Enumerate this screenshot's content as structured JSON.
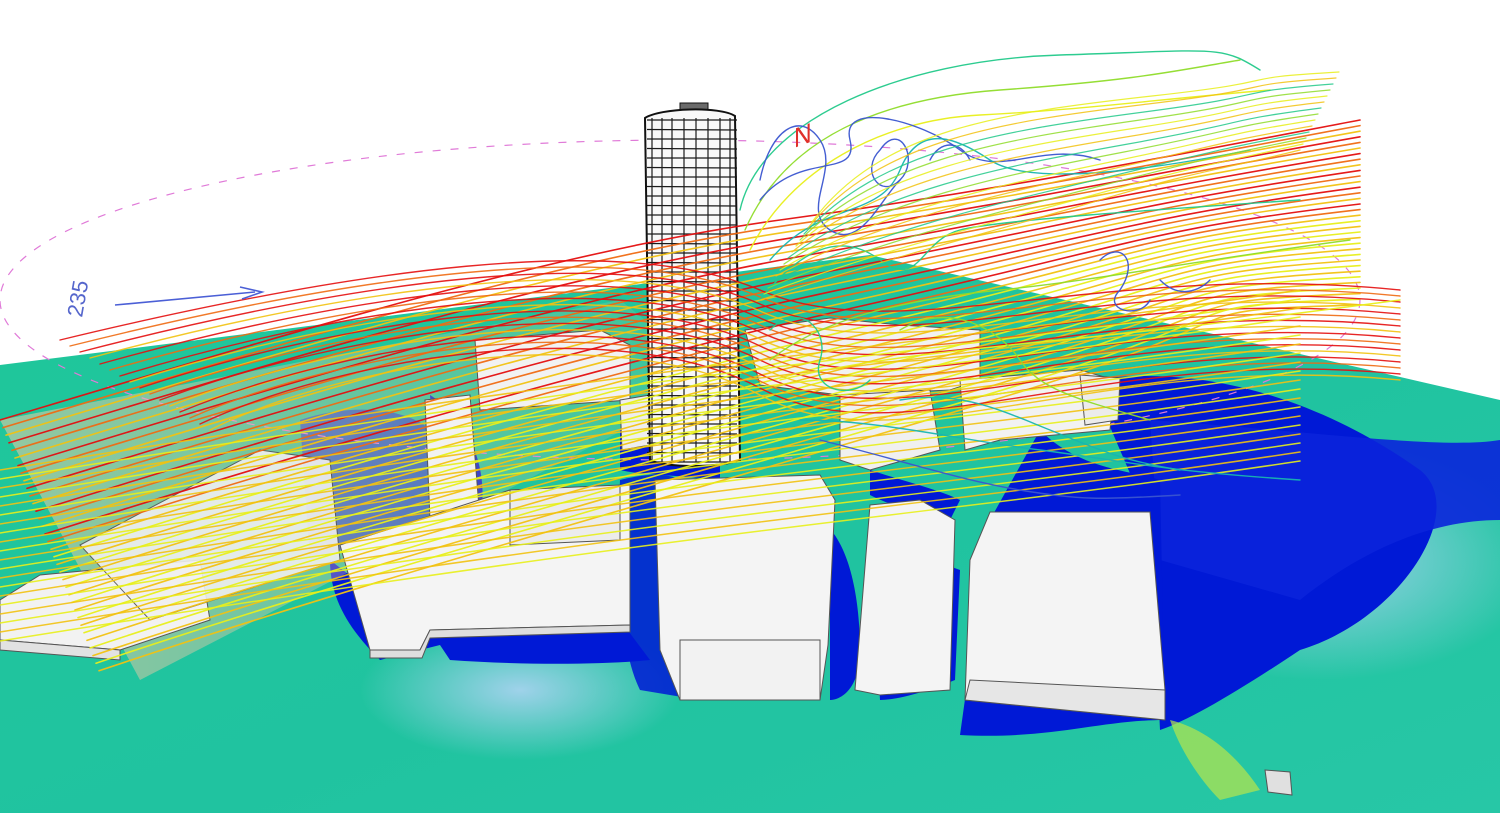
{
  "scene": {
    "wind_direction_label": "235",
    "north_label": "N",
    "colors": {
      "background": "#ffffff",
      "ground_calm": "#1fc79a",
      "ground_fast": "#0019d6",
      "ground_mid": "#7fb9e0",
      "building_fill": "#f2f2f2",
      "building_edge": "#555555",
      "tower_frame": "#111111",
      "compass_ring": "#e07ad8",
      "wind_arrow": "#4b5fd6",
      "north_marker": "#e0302a"
    },
    "streamline_palette": [
      "#e40e0e",
      "#f06a12",
      "#f2c211",
      "#e8ef1a",
      "#8fdc2a",
      "#22c98a",
      "#18b5b0",
      "#3a55d0"
    ],
    "icons": [
      "wind-direction-arrow-icon",
      "north-marker-icon"
    ]
  }
}
